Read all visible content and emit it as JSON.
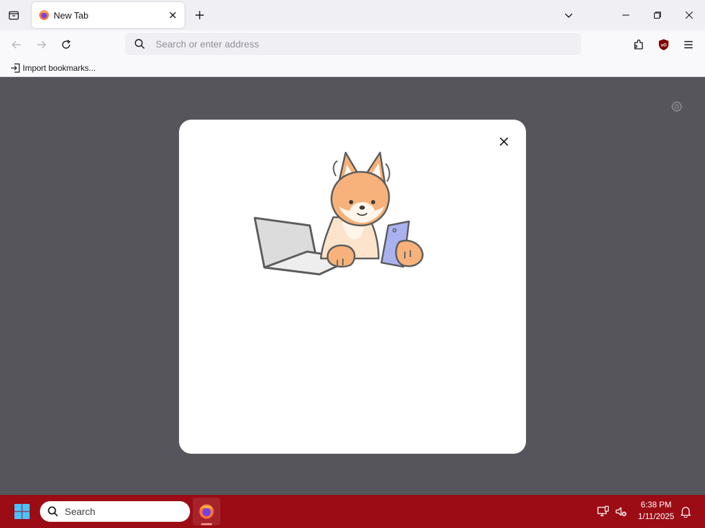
{
  "browser": {
    "tab": {
      "title": "New Tab",
      "favicon": "firefox-icon"
    },
    "urlbar": {
      "placeholder": "Search or enter address",
      "value": ""
    },
    "bookmarks": [
      {
        "label": "Import bookmarks...",
        "icon": "import-icon"
      }
    ],
    "icons": [
      "tab-list-icon",
      "close-icon",
      "plus-icon",
      "chevron-down-icon",
      "minimize-icon",
      "restore-icon",
      "back-icon",
      "forward-icon",
      "reload-icon",
      "search-icon",
      "extensions-icon",
      "ublock-icon",
      "hamburger-menu-icon"
    ]
  },
  "content": {
    "background": "#55555b",
    "dialog": {
      "illustration": "fox-with-laptop-and-phone",
      "close_icon": "close-icon"
    }
  },
  "taskbar": {
    "search_label": "Search",
    "clock": {
      "time": "6:38 PM",
      "date": "1/11/2025"
    },
    "color": "#9b0c15"
  }
}
